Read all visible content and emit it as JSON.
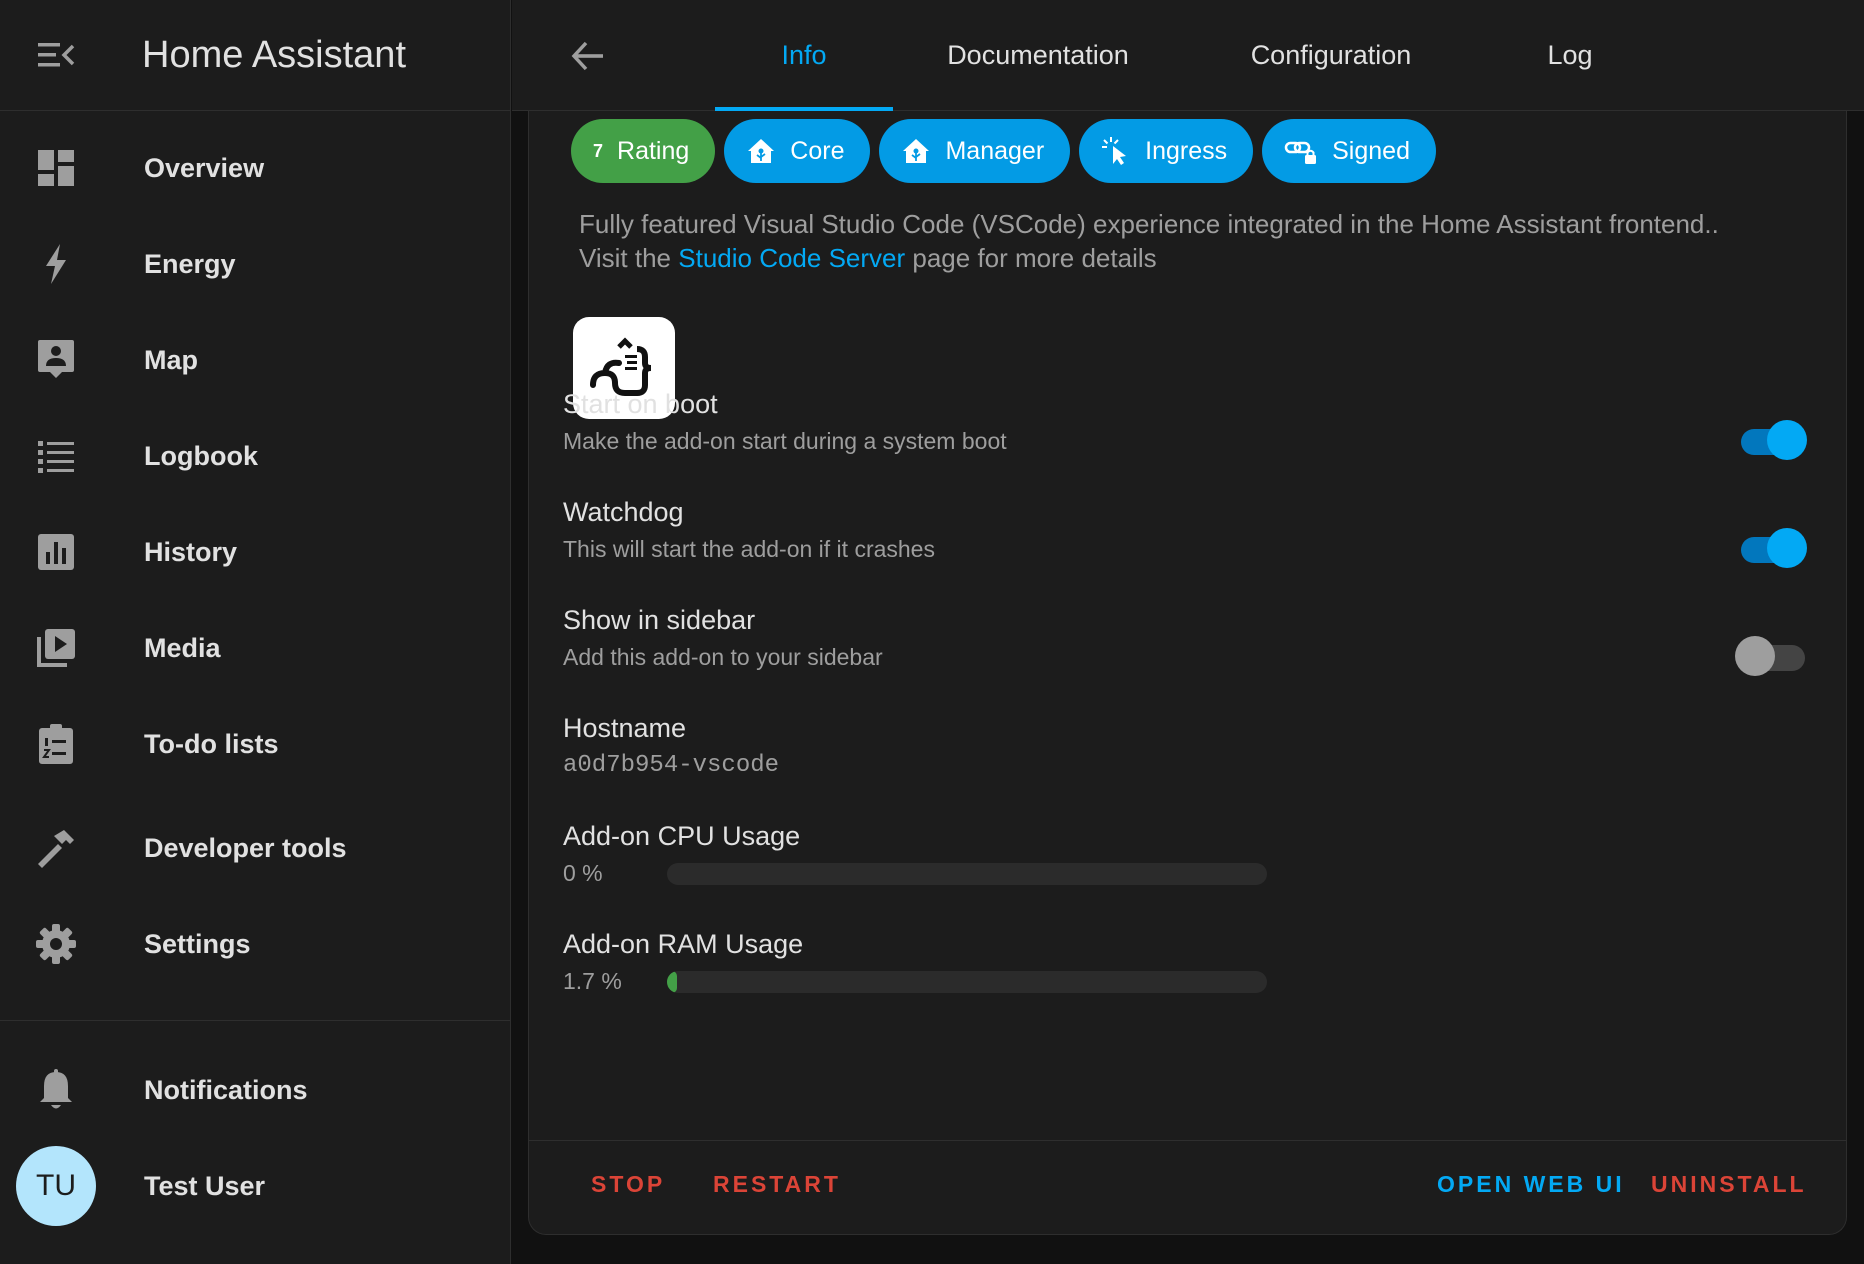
{
  "app": {
    "title": "Home Assistant"
  },
  "sidebar": {
    "items": [
      {
        "label": "Overview",
        "icon": "dashboard-icon"
      },
      {
        "label": "Energy",
        "icon": "lightning-icon"
      },
      {
        "label": "Map",
        "icon": "map-person-icon"
      },
      {
        "label": "Logbook",
        "icon": "list-icon"
      },
      {
        "label": "History",
        "icon": "bar-chart-icon"
      },
      {
        "label": "Media",
        "icon": "media-play-icon"
      },
      {
        "label": "To-do lists",
        "icon": "clipboard-list-icon"
      },
      {
        "label": "Developer tools",
        "icon": "hammer-icon"
      },
      {
        "label": "Settings",
        "icon": "gear-icon"
      }
    ],
    "notifications": {
      "label": "Notifications"
    },
    "user": {
      "initials": "TU",
      "name": "Test User"
    }
  },
  "tabs": [
    {
      "label": "Info",
      "active": true
    },
    {
      "label": "Documentation",
      "active": false
    },
    {
      "label": "Configuration",
      "active": false
    },
    {
      "label": "Log",
      "active": false
    }
  ],
  "badges": [
    {
      "label": "Rating",
      "value": "7",
      "color": "#43a047"
    },
    {
      "label": "Core",
      "color": "#039be5"
    },
    {
      "label": "Manager",
      "color": "#039be5"
    },
    {
      "label": "Ingress",
      "color": "#039be5"
    },
    {
      "label": "Signed",
      "color": "#039be5"
    }
  ],
  "description": {
    "line1": "Fully featured Visual Studio Code (VSCode) experience integrated in the Home Assistant frontend..",
    "visit_prefix": "Visit the ",
    "link_text": "Studio Code Server",
    "visit_suffix": " page for more details"
  },
  "options": {
    "start_on_boot": {
      "title": "Start on boot",
      "subtitle": "Make the add-on start during a system boot",
      "enabled": true
    },
    "watchdog": {
      "title": "Watchdog",
      "subtitle": "This will start the add-on if it crashes",
      "enabled": true
    },
    "show_in_sidebar": {
      "title": "Show in sidebar",
      "subtitle": "Add this add-on to your sidebar",
      "enabled": false
    }
  },
  "hostname": {
    "title": "Hostname",
    "value": "a0d7b954-vscode"
  },
  "cpu": {
    "title": "Add-on CPU Usage",
    "value_text": "0 %",
    "percent": 0
  },
  "ram": {
    "title": "Add-on RAM Usage",
    "value_text": "1.7 %",
    "percent": 1.7
  },
  "actions": {
    "stop": "STOP",
    "restart": "RESTART",
    "open_web_ui": "OPEN WEB UI",
    "uninstall": "UNINSTALL"
  },
  "colors": {
    "accent": "#03a9f4",
    "danger": "#db4437",
    "success": "#43a047",
    "background": "#111111",
    "surface": "#1c1c1c"
  }
}
